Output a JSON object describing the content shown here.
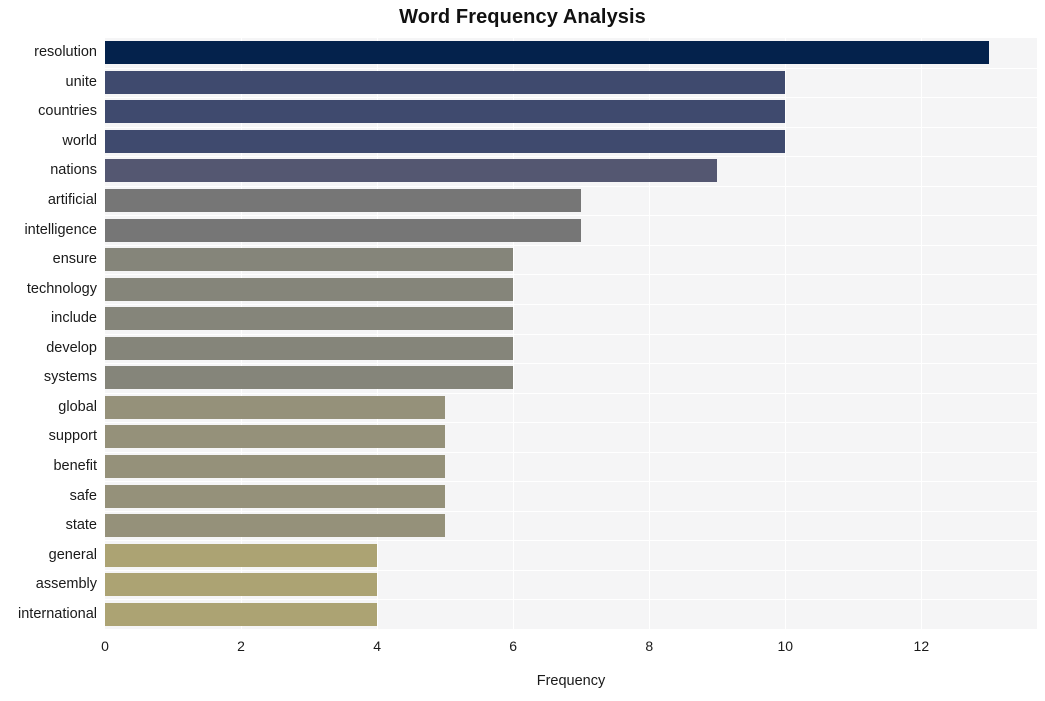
{
  "chart_data": {
    "type": "bar",
    "orientation": "horizontal",
    "title": "Word Frequency Analysis",
    "xlabel": "Frequency",
    "ylabel": "",
    "categories": [
      "resolution",
      "unite",
      "countries",
      "world",
      "nations",
      "artificial",
      "intelligence",
      "ensure",
      "technology",
      "include",
      "develop",
      "systems",
      "global",
      "support",
      "benefit",
      "safe",
      "state",
      "general",
      "assembly",
      "international"
    ],
    "values": [
      13,
      10,
      10,
      10,
      9,
      7,
      7,
      6,
      6,
      6,
      6,
      6,
      5,
      5,
      5,
      5,
      5,
      4,
      4,
      4
    ],
    "bar_colors": [
      "#04224c",
      "#3f4a6e",
      "#3f4a6e",
      "#3f4a6e",
      "#545771",
      "#767676",
      "#767676",
      "#85857a",
      "#85857a",
      "#85857a",
      "#85857a",
      "#85857a",
      "#95917a",
      "#95917a",
      "#95917a",
      "#95917a",
      "#95917a",
      "#aca373",
      "#aca373",
      "#aca373"
    ],
    "xticks": [
      0,
      2,
      4,
      6,
      8,
      10,
      12
    ],
    "xtick_labels": [
      "0",
      "2",
      "4",
      "6",
      "8",
      "10",
      "12"
    ],
    "xlim": [
      0,
      13.7
    ],
    "grid": true,
    "grid_color": "#ffffff",
    "plot_background": "#f5f5f6",
    "figure_background": "#ffffff",
    "legend": null
  }
}
